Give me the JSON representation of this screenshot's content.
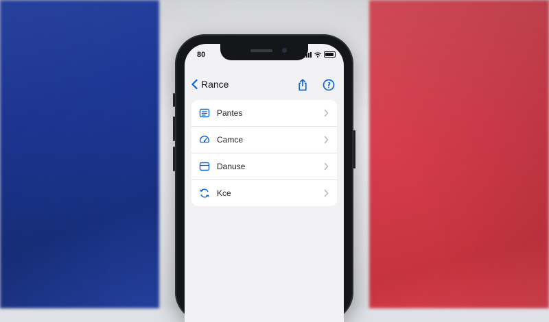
{
  "colors": {
    "flag_blue": "#1f3a9e",
    "flag_white": "#f1f1f3",
    "flag_red": "#d63c4c",
    "accent": "#0a66d8"
  },
  "status_bar": {
    "time": "80",
    "icons": [
      "cellular-signal-icon",
      "wifi-icon",
      "battery-icon"
    ]
  },
  "navbar": {
    "back_label": "Rance",
    "icons": [
      "share-icon",
      "info-icon"
    ]
  },
  "list": {
    "items": [
      {
        "label": "Pantes",
        "icon": "list-icon"
      },
      {
        "label": "Camce",
        "icon": "speedometer-icon"
      },
      {
        "label": "Danuse",
        "icon": "card-icon"
      },
      {
        "label": "Kce",
        "icon": "refresh-icon"
      }
    ]
  }
}
